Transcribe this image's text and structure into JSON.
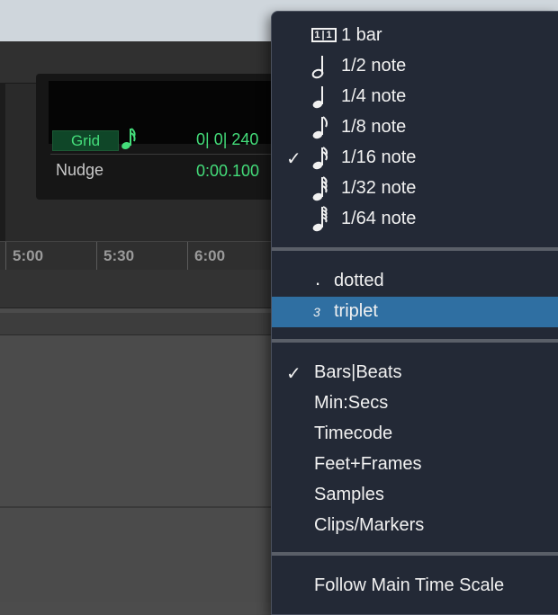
{
  "grid_panel": {
    "grid_label": "Grid",
    "grid_value": "0| 0| 240",
    "nudge_label": "Nudge",
    "nudge_value": "0:00.100"
  },
  "ruler": {
    "labels": [
      "5:00",
      "5:30",
      "6:00"
    ]
  },
  "menu": {
    "note_items": [
      {
        "label": "1 bar",
        "icon": "bar-icon",
        "checked": false
      },
      {
        "label": "1/2 note",
        "icon": "half-note-icon",
        "checked": false
      },
      {
        "label": "1/4 note",
        "icon": "quarter-note-icon",
        "checked": false
      },
      {
        "label": "1/8 note",
        "icon": "eighth-note-icon",
        "checked": false
      },
      {
        "label": "1/16 note",
        "icon": "sixteenth-note-icon",
        "checked": true
      },
      {
        "label": "1/32 note",
        "icon": "thirty-second-note-icon",
        "checked": false
      },
      {
        "label": "1/64 note",
        "icon": "sixty-fourth-note-icon",
        "checked": false
      }
    ],
    "modifier_items": [
      {
        "label": "dotted",
        "icon": "dot-icon",
        "highlighted": false
      },
      {
        "label": "triplet",
        "icon": "triplet-icon",
        "highlighted": true
      }
    ],
    "bar_icon_text": "1|1",
    "dot_symbol": ".",
    "triplet_symbol": "3",
    "check_symbol": "✓",
    "timescale_items": [
      {
        "label": "Bars|Beats",
        "checked": true
      },
      {
        "label": "Min:Secs",
        "checked": false
      },
      {
        "label": "Timecode",
        "checked": false
      },
      {
        "label": "Feet+Frames",
        "checked": false
      },
      {
        "label": "Samples",
        "checked": false
      },
      {
        "label": "Clips/Markers",
        "checked": false
      }
    ],
    "follow_label": "Follow Main Time Scale"
  },
  "colors": {
    "menu_bg": "#232936",
    "highlight": "#2f6fa2",
    "grid_green": "#44dd7a"
  }
}
